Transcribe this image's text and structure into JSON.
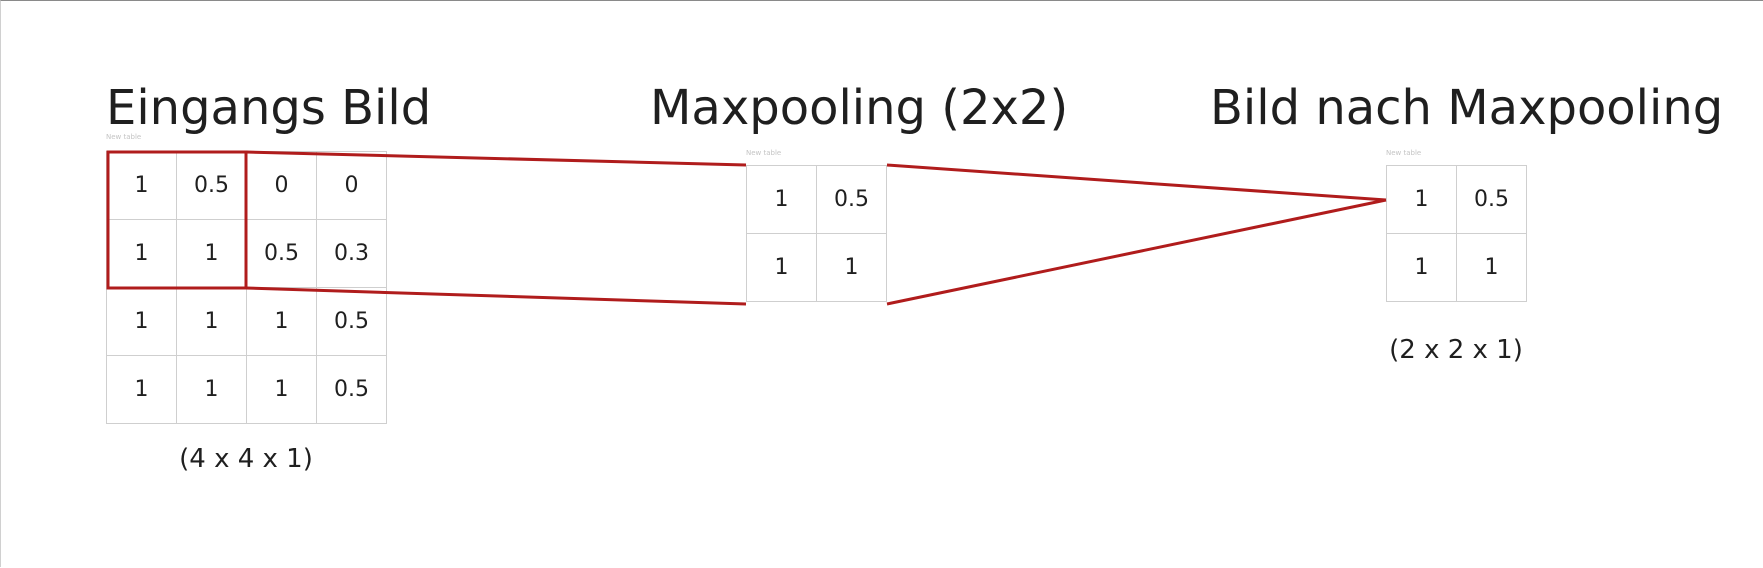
{
  "diagram": {
    "input": {
      "title": "Eingangs Bild",
      "tag": "New table",
      "rows": [
        [
          "1",
          "0.5",
          "0",
          "0"
        ],
        [
          "1",
          "1",
          "0.5",
          "0.3"
        ],
        [
          "1",
          "1",
          "1",
          "0.5"
        ],
        [
          "1",
          "1",
          "1",
          "0.5"
        ]
      ],
      "dims": "(4 x 4 x 1)"
    },
    "pool": {
      "title": "Maxpooling (2x2)",
      "tag": "New table",
      "rows": [
        [
          "1",
          "0.5"
        ],
        [
          "1",
          "1"
        ]
      ]
    },
    "output": {
      "title": "Bild nach Maxpooling",
      "tag": "New table",
      "rows": [
        [
          "1",
          "0.5"
        ],
        [
          "1",
          "1"
        ]
      ],
      "dims": "(2 x 2 x 1)"
    },
    "colors": {
      "highlight": "#b01c1c",
      "grid": "#cfcfcf",
      "text": "#1f1f1f"
    }
  }
}
